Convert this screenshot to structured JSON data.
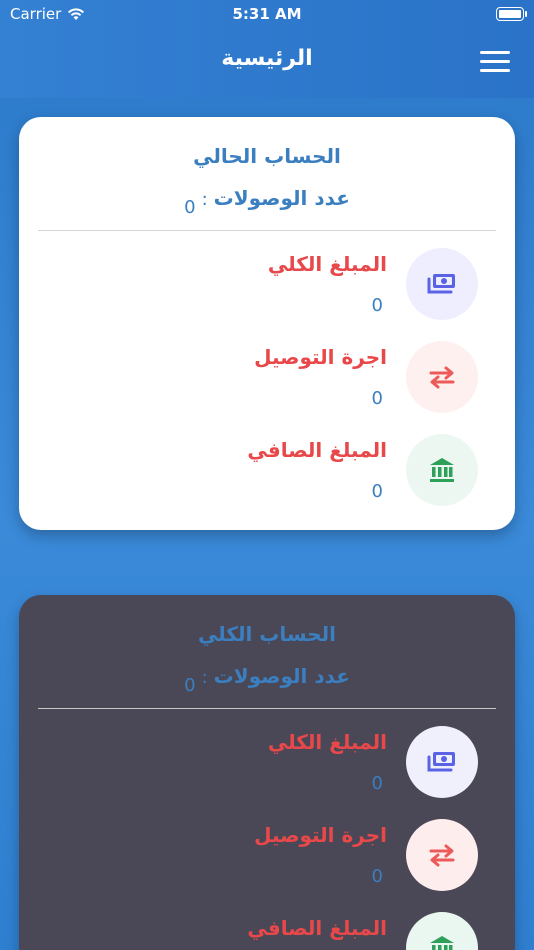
{
  "status_bar": {
    "carrier": "Carrier",
    "time": "5:31 AM"
  },
  "header": {
    "title": "الرئيسية",
    "menu_icon": "hamburger-menu-icon"
  },
  "colors": {
    "header": "#2f7bcf",
    "accent_blue": "#3b7fc0",
    "accent_red": "#e8484a",
    "card_light": "#ffffff",
    "card_dark": "#4a4756"
  },
  "current_account": {
    "title": "الحساب الحالي",
    "count_label": "عدد الوصولات",
    "count_separator": ":",
    "count_value": "0",
    "rows": [
      {
        "label": "المبلغ الكلي",
        "value": "0",
        "icon": "cash-icon"
      },
      {
        "label": "اجرة التوصيل",
        "value": "0",
        "icon": "transfer-arrows-icon"
      },
      {
        "label": "المبلغ الصافي",
        "value": "0",
        "icon": "bank-icon"
      }
    ]
  },
  "total_account": {
    "title": "الحساب الكلي",
    "count_label": "عدد الوصولات",
    "count_separator": ":",
    "count_value": "0",
    "rows": [
      {
        "label": "المبلغ الكلي",
        "value": "0",
        "icon": "cash-icon"
      },
      {
        "label": "اجرة التوصيل",
        "value": "0",
        "icon": "transfer-arrows-icon"
      },
      {
        "label": "المبلغ الصافي",
        "value": "",
        "icon": "bank-icon"
      }
    ]
  }
}
